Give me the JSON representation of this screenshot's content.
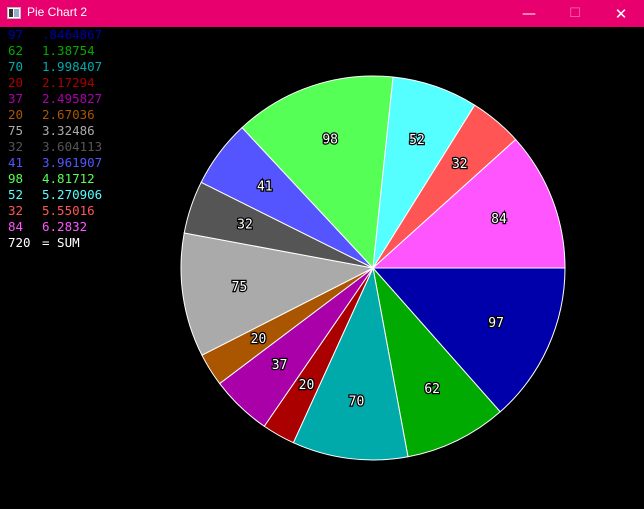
{
  "window": {
    "title": "Pie Chart 2",
    "minimize_glyph": "—",
    "maximize_glyph": "☐",
    "close_glyph": "✕",
    "titlebar_color": "#e8006f"
  },
  "chart_data": {
    "type": "pie",
    "values": [
      97,
      62,
      70,
      20,
      37,
      20,
      75,
      32,
      41,
      98,
      52,
      32,
      84
    ],
    "cumulative_angles": [
      ".8464867",
      "1.38754",
      "1.998407",
      "2.17294",
      "2.495827",
      "2.67036",
      "3.32486",
      "3.604113",
      "3.961907",
      "4.81712",
      "5.270906",
      "5.55016",
      "6.2832"
    ],
    "colors": [
      "#0000aa",
      "#00aa00",
      "#00aaaa",
      "#aa0000",
      "#aa00aa",
      "#aa5500",
      "#aaaaaa",
      "#555555",
      "#5555ff",
      "#55ff55",
      "#55ffff",
      "#ff5555",
      "#ff55ff"
    ],
    "sum_value": 720,
    "sum_label": "= SUM",
    "sum_color": "#ffffff"
  }
}
